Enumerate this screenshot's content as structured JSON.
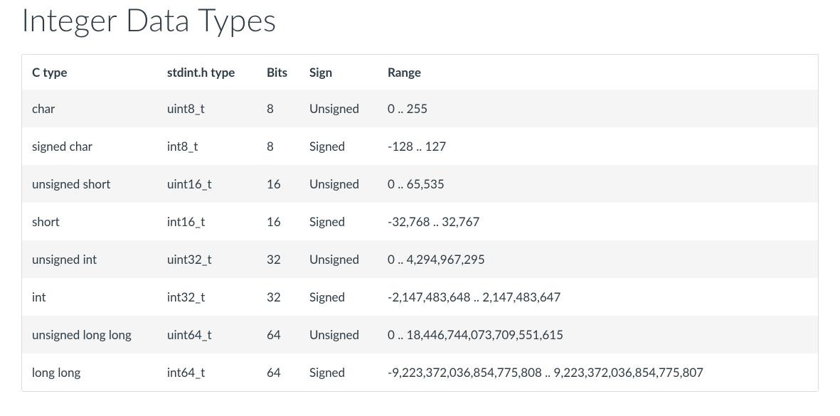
{
  "title": "Integer Data Types",
  "table": {
    "headers": {
      "ctype": "C type",
      "stdint": "stdint.h type",
      "bits": "Bits",
      "sign": "Sign",
      "range": "Range"
    },
    "rows": [
      {
        "ctype": "char",
        "stdint": "uint8_t",
        "bits": "8",
        "sign": "Unsigned",
        "range": "0 .. 255"
      },
      {
        "ctype": "signed char",
        "stdint": "int8_t",
        "bits": "8",
        "sign": "Signed",
        "range": "-128 .. 127"
      },
      {
        "ctype": "unsigned short",
        "stdint": "uint16_t",
        "bits": "16",
        "sign": "Unsigned",
        "range": "0 .. 65,535"
      },
      {
        "ctype": "short",
        "stdint": "int16_t",
        "bits": "16",
        "sign": "Signed",
        "range": "-32,768 .. 32,767"
      },
      {
        "ctype": "unsigned int",
        "stdint": "uint32_t",
        "bits": "32",
        "sign": "Unsigned",
        "range": "0 .. 4,294,967,295"
      },
      {
        "ctype": "int",
        "stdint": "int32_t",
        "bits": "32",
        "sign": "Signed",
        "range": "-2,147,483,648 .. 2,147,483,647"
      },
      {
        "ctype": "unsigned long long",
        "stdint": "uint64_t",
        "bits": "64",
        "sign": "Unsigned",
        "range": "0 .. 18,446,744,073,709,551,615"
      },
      {
        "ctype": "long long",
        "stdint": "int64_t",
        "bits": "64",
        "sign": "Signed",
        "range": "-9,223,372,036,854,775,808 .. 9,223,372,036,854,775,807"
      }
    ]
  }
}
